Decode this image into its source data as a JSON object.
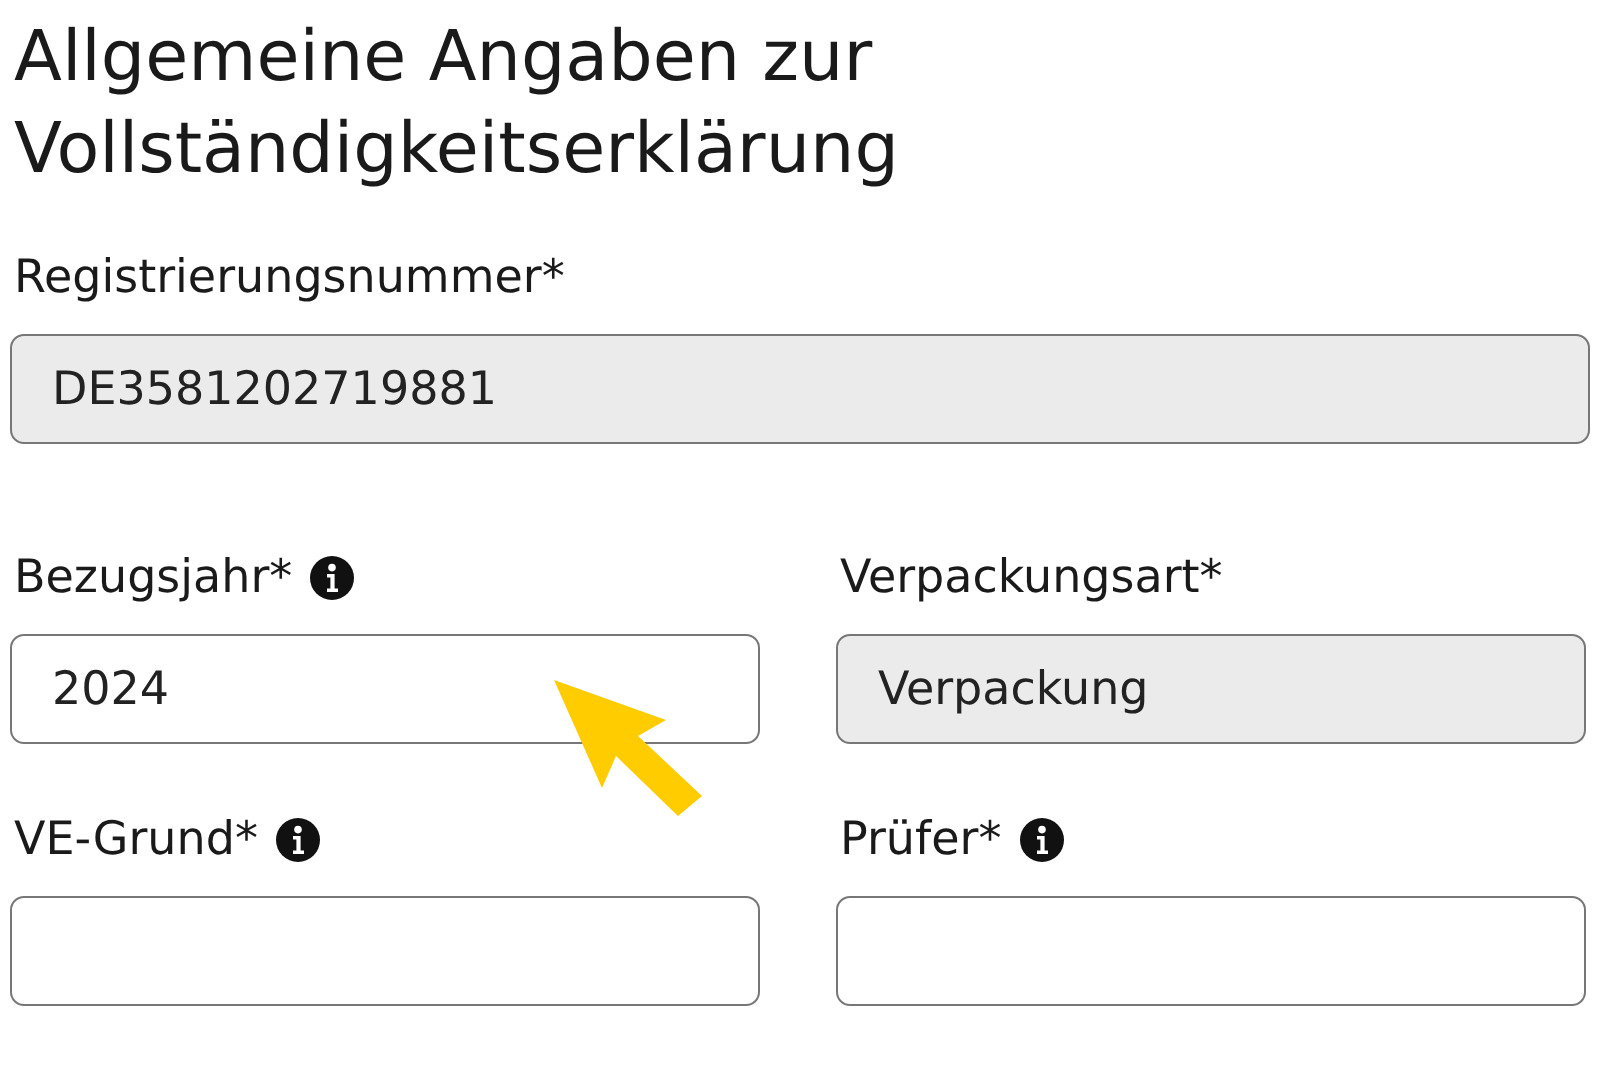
{
  "title": "Allgemeine Angaben zur Vollständigkeitserklärung",
  "fields": [
    {
      "label": "Registrierungsnummer*",
      "value": "DE3581202719881",
      "info": false,
      "disabled": true,
      "kind": "wide"
    },
    {
      "label": "Bezugsjahr*",
      "value": "2024",
      "info": true,
      "disabled": false,
      "kind": "half"
    },
    {
      "label": "Verpackungsart*",
      "value": "Verpackung",
      "info": false,
      "disabled": true,
      "kind": "half"
    },
    {
      "label": "VE-Grund*",
      "info": true,
      "disabled": false,
      "kind": "half"
    },
    {
      "label": "Prüfer*",
      "info": true,
      "disabled": false,
      "kind": "half"
    }
  ]
}
